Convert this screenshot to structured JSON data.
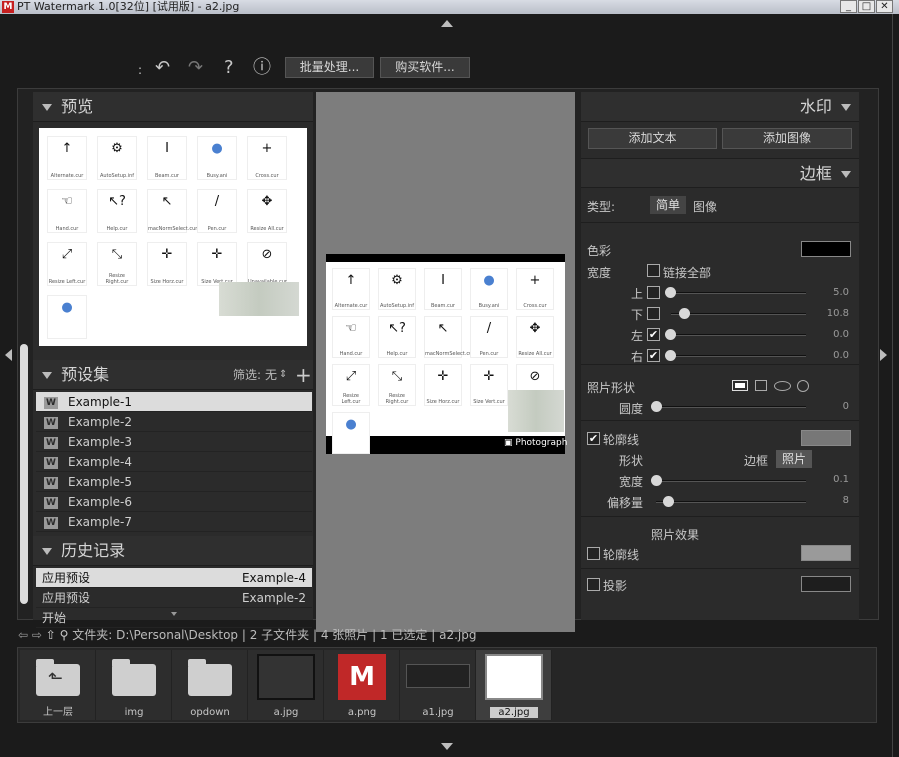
{
  "window": {
    "logo": "M",
    "title": "PT Watermark 1.0[32位] [试用版] - a2.jpg"
  },
  "toolbar": {
    "batch_label": "批量处理...",
    "buy_label": "购买软件...",
    "help_glyph": "?",
    "info_glyph": "ⓘ",
    "sep_glyph": ":"
  },
  "left": {
    "preview_title": "预览",
    "presets_title": "预设集",
    "filter_label": "筛选:",
    "filter_value": "无",
    "add_glyph": "+",
    "presets": [
      "Example-1",
      "Example-2",
      "Example-3",
      "Example-4",
      "Example-5",
      "Example-6",
      "Example-7"
    ],
    "history_title": "历史记录",
    "history": [
      {
        "action": "应用预设",
        "value": "Example-4",
        "selected": true
      },
      {
        "action": "应用预设",
        "value": "Example-2",
        "selected": false
      },
      {
        "action": "开始",
        "value": "",
        "selected": false
      }
    ]
  },
  "thumb_icons": [
    {
      "glyph": "↑",
      "name": "Alternate.cur"
    },
    {
      "glyph": "⚙",
      "name": "AutoSetup.inf"
    },
    {
      "glyph": "I",
      "name": "Beam.cur"
    },
    {
      "glyph": "●",
      "name": "Busy.ani"
    },
    {
      "glyph": "+",
      "name": "Cross.cur"
    },
    {
      "glyph": "☜",
      "name": "Hand.cur"
    },
    {
      "glyph": "↖?",
      "name": "Help.cur"
    },
    {
      "glyph": "↖",
      "name": "macNormSelect.cur"
    },
    {
      "glyph": "/",
      "name": "Pen.cur"
    },
    {
      "glyph": "✥",
      "name": "Resize All.cur"
    },
    {
      "glyph": "⤢",
      "name": "Resize Left.cur"
    },
    {
      "glyph": "⤡",
      "name": "Resize Right.cur"
    },
    {
      "glyph": "✛",
      "name": "Size Horz.cur"
    },
    {
      "glyph": "✛",
      "name": "Size Vert.cur"
    },
    {
      "glyph": "⊘",
      "name": "Unavailable.cur"
    },
    {
      "glyph": "●",
      "name": ""
    }
  ],
  "canvas": {
    "watermark_text": "Photograph"
  },
  "right": {
    "watermark_title": "水印",
    "add_text_label": "添加文本",
    "add_image_label": "添加图像",
    "border_title": "边框",
    "type_label": "类型:",
    "type_simple": "简单",
    "type_image": "图像",
    "color_label": "色彩",
    "border_color": "#000000",
    "width_label": "宽度",
    "link_all_label": "链接全部",
    "sides": [
      {
        "label": "上",
        "checked": false,
        "value": "5.0",
        "fraction": 0.0
      },
      {
        "label": "下",
        "checked": false,
        "value": "10.8",
        "fraction": 0.1
      },
      {
        "label": "左",
        "checked": true,
        "value": "0.0",
        "fraction": 0.0
      },
      {
        "label": "右",
        "checked": true,
        "value": "0.0",
        "fraction": 0.0
      }
    ],
    "shape_label": "照片形状",
    "roundness_label": "圆度",
    "roundness_value": "0",
    "outline_label": "轮廓线",
    "outline_checked": true,
    "outline_color": "#777777",
    "outline_shape_label": "形状",
    "outline_border_opt": "边框",
    "outline_photo_opt": "照片",
    "outline_width_label": "宽度",
    "outline_width_value": "0.1",
    "offset_label": "偏移量",
    "offset_value": "8",
    "effects_title": "照片效果",
    "effect_outline_label": "轮廓线",
    "effect_outline_color": "#9a9a9a",
    "shadow_label": "投影",
    "shadow_color": "#1e1e1e"
  },
  "pathbar": {
    "folder_label": "文件夹:",
    "path": "D:\\Personal\\Desktop",
    "summary": "| 2 子文件夹 | 4 张照片 | 1 已选定 | a2.jpg"
  },
  "filmstrip": [
    {
      "name": "上一层",
      "kind": "up"
    },
    {
      "name": "img",
      "kind": "folder"
    },
    {
      "name": "opdown",
      "kind": "folder"
    },
    {
      "name": "a.jpg",
      "kind": "photo-dark"
    },
    {
      "name": "a.png",
      "kind": "photo-logo"
    },
    {
      "name": "a1.jpg",
      "kind": "photo-dark2"
    },
    {
      "name": "a2.jpg",
      "kind": "photo-white",
      "selected": true
    }
  ]
}
